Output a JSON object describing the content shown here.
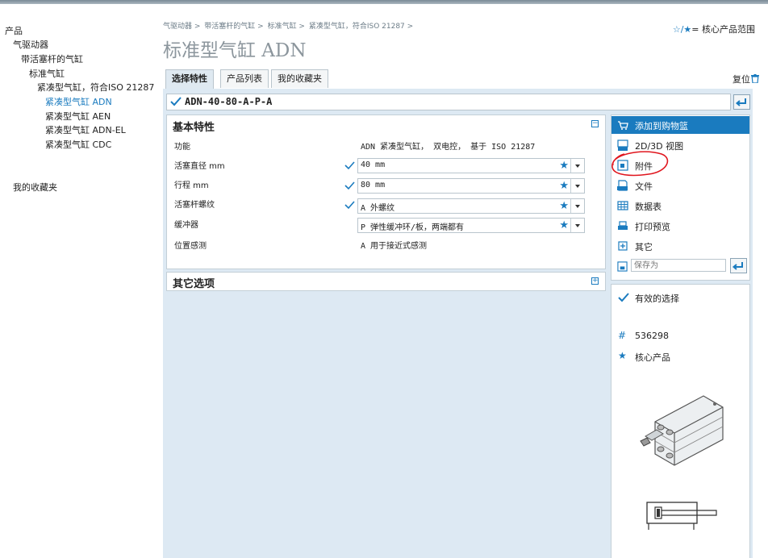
{
  "tree": [
    {
      "label": "产品",
      "level": 0,
      "active": false
    },
    {
      "label": "气驱动器",
      "level": 1,
      "active": false
    },
    {
      "label": "带活塞杆的气缸",
      "level": 2,
      "active": false
    },
    {
      "label": "标准气缸",
      "level": 3,
      "active": false
    },
    {
      "label": "紧凑型气缸，符合ISO 21287",
      "level": 4,
      "active": false
    },
    {
      "label": "紧凑型气缸 ADN",
      "level": 5,
      "active": true
    },
    {
      "label": "紧凑型气缸 AEN",
      "level": 5,
      "active": false
    },
    {
      "label": "紧凑型气缸 ADN-EL",
      "level": 5,
      "active": false
    },
    {
      "label": "紧凑型气缸 CDC",
      "level": 5,
      "active": false
    }
  ],
  "favorites_link": "我的收藏夹",
  "breadcrumb": [
    "气驱动器 >",
    "带活塞杆的气缸 >",
    "标准气缸 >",
    "紧凑型气缸，符合ISO 21287 >"
  ],
  "title": "标准型气缸 ADN",
  "core_legend": {
    "prefix": "☆/★",
    "text": "= 核心产品范围"
  },
  "tabs": [
    {
      "label": "选择特性",
      "selected": true
    },
    {
      "label": "产品列表",
      "selected": false
    },
    {
      "label": "我的收藏夹",
      "selected": false
    }
  ],
  "reset_label": "复位",
  "type_code": "ADN-40-80-A-P-A",
  "basic_panel": {
    "title": "基本特性",
    "rows": [
      {
        "label": "功能",
        "value": "ADN 紧凑型气缸， 双电控， 基于 ISO 21287"
      },
      {
        "label": "活塞直径 mm",
        "value": "40 mm"
      },
      {
        "label": "行程 mm",
        "value": "80 mm"
      },
      {
        "label": "活塞杆螺纹",
        "value": "A 外螺纹"
      },
      {
        "label": "缓冲器",
        "value": "P 弹性缓冲环/板，两端都有"
      },
      {
        "label": "位置感测",
        "value": "A 用于接近式感测"
      }
    ]
  },
  "other_panel": {
    "title": "其它选项"
  },
  "actions": [
    {
      "label": "添加到购物篮",
      "icon": "cart-icon",
      "highlighted": true
    },
    {
      "label": "2D/3D 视图",
      "icon": "cad-icon"
    },
    {
      "label": "附件",
      "icon": "accessory-icon"
    },
    {
      "label": "文件",
      "icon": "pdf-icon"
    },
    {
      "label": "数据表",
      "icon": "table-icon"
    },
    {
      "label": "打印预览",
      "icon": "print-icon"
    },
    {
      "label": "其它",
      "icon": "plus-icon"
    }
  ],
  "save_as_placeholder": "保存为",
  "info": {
    "valid_label": "有效的选择",
    "part_number": "536298",
    "core_label": "核心产品"
  },
  "colors": {
    "accent": "#1a7bbf",
    "panel_bg": "#dde9f3",
    "annotation": "#e0161e"
  }
}
